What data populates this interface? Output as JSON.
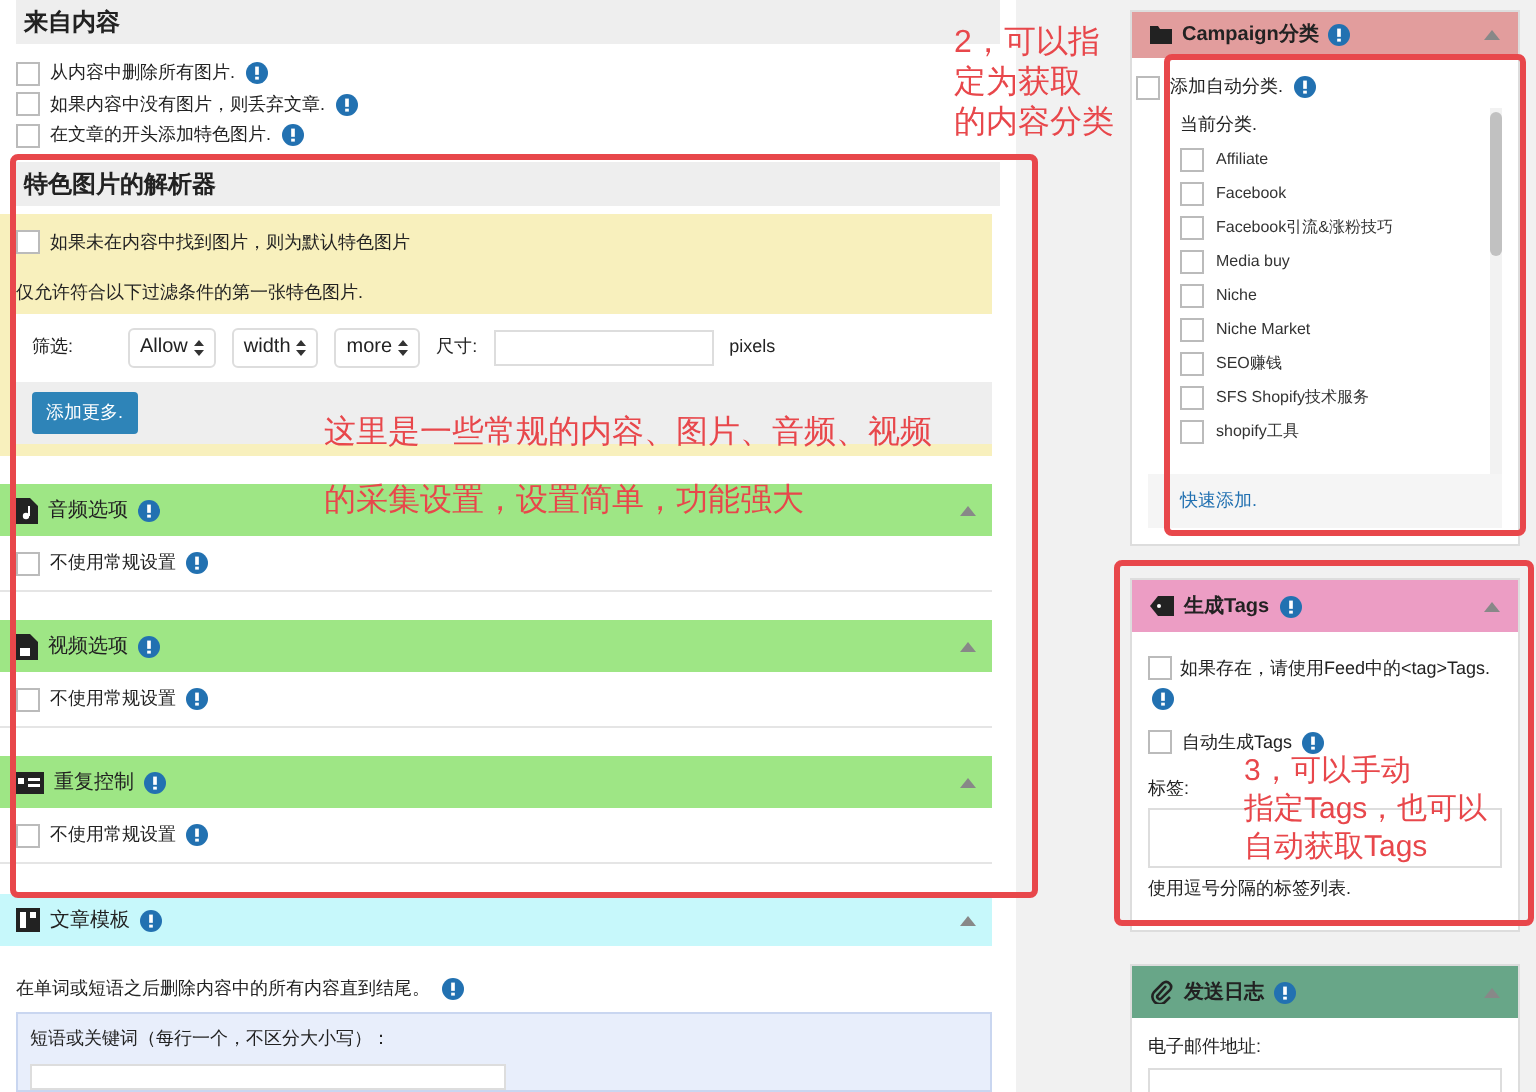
{
  "content_section": {
    "title": "来自内容",
    "options": [
      {
        "label": "从内容中删除所有图片.",
        "checked": false
      },
      {
        "label": "如果内容中没有图片，则丢弃文章.",
        "checked": false
      },
      {
        "label": "在文章的开头添加特色图片.",
        "checked": false
      }
    ]
  },
  "featured_image": {
    "title": "特色图片的解析器",
    "default_option": {
      "label": "如果未在内容中找到图片，则为默认特色图片",
      "checked": false
    },
    "filter_note": "仅允许符合以下过滤条件的第一张特色图片.",
    "filter": {
      "label": "筛选:",
      "selects": [
        "Allow",
        "width",
        "more"
      ],
      "size_label": "尺寸:",
      "unit": "pixels"
    },
    "add_button": "添加更多."
  },
  "media_sections": [
    {
      "kind": "audio",
      "title": "音频选项",
      "option": {
        "label": "不使用常规设置",
        "checked": false
      }
    },
    {
      "kind": "video",
      "title": "视频选项",
      "option": {
        "label": "不使用常规设置",
        "checked": false
      }
    },
    {
      "kind": "duplicate",
      "title": "重复控制",
      "option": {
        "label": "不使用常规设置",
        "checked": false
      }
    }
  ],
  "template": {
    "title": "文章模板",
    "note": "在单词或短语之后删除内容中的所有内容直到结尾。",
    "keyword_label": "短语或关键词（每行一个，不区分大小写）："
  },
  "sidebar": {
    "campaign": {
      "title": "Campaign分类",
      "auto_option": {
        "label": "添加自动分类.",
        "checked": false
      },
      "current_label": "当前分类.",
      "categories": [
        {
          "label": "Affiliate",
          "checked": false
        },
        {
          "label": "Facebook",
          "checked": false
        },
        {
          "label": "Facebook引流&涨粉技巧",
          "checked": false
        },
        {
          "label": "Media buy",
          "checked": false
        },
        {
          "label": "Niche",
          "checked": false
        },
        {
          "label": "Niche Market",
          "checked": false
        },
        {
          "label": "SEO赚钱",
          "checked": false
        },
        {
          "label": "SFS Shopify技术服务",
          "checked": false
        },
        {
          "label": "shopify工具",
          "checked": false
        }
      ],
      "quick_add": "快速添加."
    },
    "tags": {
      "title": "生成Tags",
      "feed_option": {
        "label": "如果存在，请使用Feed中的<tag>Tags.",
        "checked": false
      },
      "auto_option": {
        "label": "自动生成Tags",
        "checked": false
      },
      "tags_label": "标签:",
      "hint": "使用逗号分隔的标签列表."
    },
    "log": {
      "title": "发送日志",
      "email_label": "电子邮件地址:"
    }
  },
  "annotations": {
    "left_note": [
      "这里是一些常规的内容、图片、音频、视频",
      "的采集设置，设置简单，功能强大"
    ],
    "category_note": [
      "2，可以指",
      "定为获取",
      "的内容分类"
    ],
    "tags_note": [
      "3，可以手动",
      "指定Tags，也可以",
      "自动获取Tags"
    ]
  }
}
